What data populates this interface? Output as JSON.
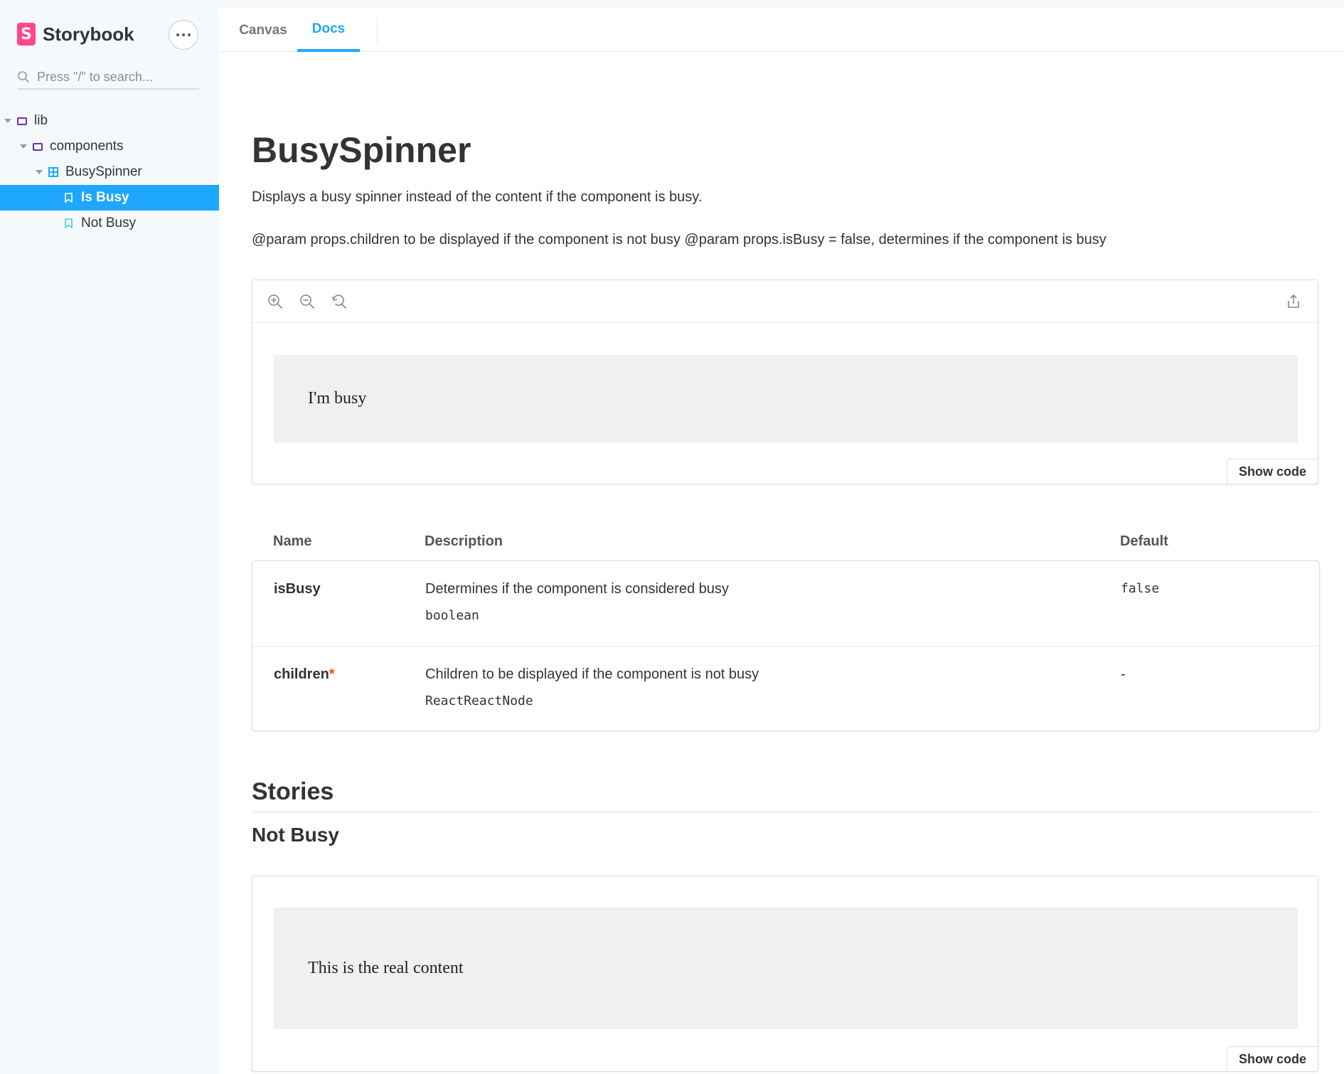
{
  "brand": {
    "name": "Storybook",
    "logo_letter": "S",
    "accent": "#ff4785"
  },
  "search": {
    "placeholder": "Press \"/\" to search..."
  },
  "tree": [
    {
      "label": "lib",
      "kind": "folder"
    },
    {
      "label": "components",
      "kind": "folder"
    },
    {
      "label": "BusySpinner",
      "kind": "component"
    },
    {
      "label": "Is Busy",
      "kind": "story",
      "selected": true
    },
    {
      "label": "Not Busy",
      "kind": "story",
      "selected": false
    }
  ],
  "tabs": {
    "canvas": "Canvas",
    "docs": "Docs",
    "active": "Docs",
    "active_color": "#1ea7fd"
  },
  "doc": {
    "title": "BusySpinner",
    "description": "Displays a busy spinner instead of the content if the component is busy.",
    "params": "@param props.children to be displayed if the component is not busy @param props.isBusy = false, determines if the component is busy",
    "primary_story": {
      "content": "I'm busy",
      "show_code": "Show code"
    },
    "props": {
      "headers": {
        "name": "Name",
        "description": "Description",
        "default": "Default"
      },
      "rows": [
        {
          "name": "isBusy",
          "required": false,
          "description": "Determines if the component is considered busy",
          "type": "boolean",
          "default": "false"
        },
        {
          "name": "children",
          "required": true,
          "description": "Children to be displayed if the component is not busy",
          "type": "ReactReactNode",
          "default": "-"
        }
      ]
    },
    "stories_heading": "Stories",
    "stories": [
      {
        "title": "Not Busy",
        "content": "This is the real content",
        "show_code": "Show code"
      }
    ]
  },
  "icons": {
    "zoom_in": "zoom-in-icon",
    "zoom_out": "zoom-out-icon",
    "zoom_reset": "zoom-reset-icon",
    "share": "share-icon",
    "search": "search-icon",
    "menu": "ellipsis-icon"
  }
}
